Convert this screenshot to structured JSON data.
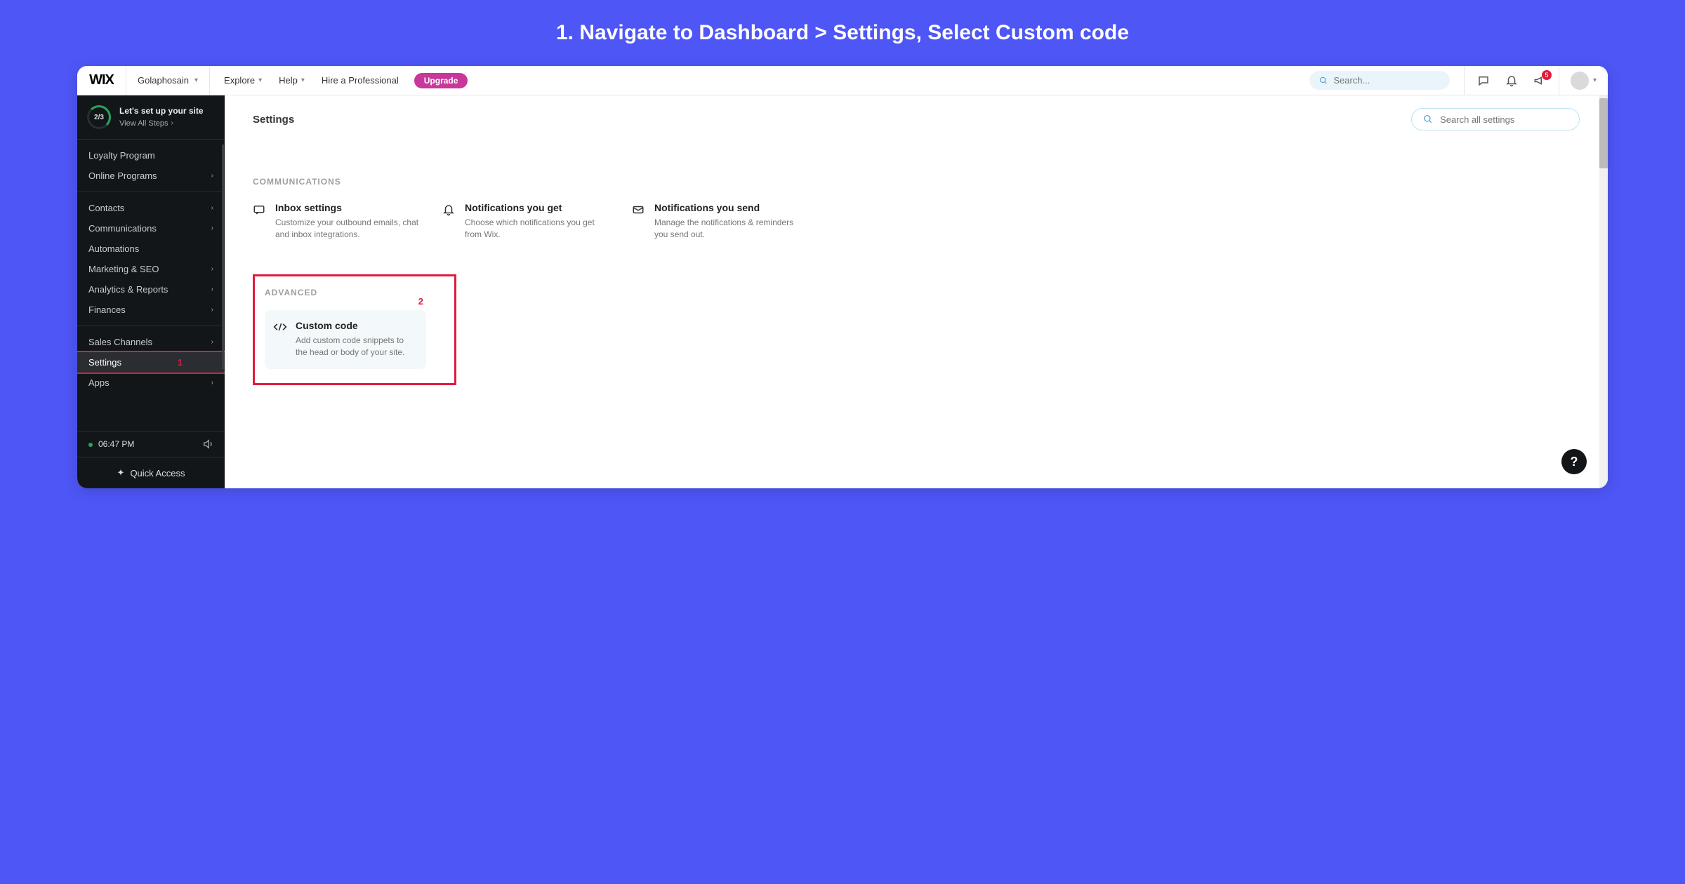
{
  "annotation_title": "1.  Navigate to Dashboard > Settings, Select Custom code",
  "topbar": {
    "logo": "WIX",
    "account_name": "Golaphosain",
    "nav": {
      "explore": "Explore",
      "help": "Help",
      "hire": "Hire a Professional"
    },
    "upgrade": "Upgrade",
    "search_placeholder": "Search...",
    "icon_badge": "5"
  },
  "sidebar": {
    "setup": {
      "progress": "2/3",
      "title": "Let's set up your site",
      "link": "View All Steps"
    },
    "group1": [
      "Loyalty Program",
      "Online Programs"
    ],
    "group2": [
      "Contacts",
      "Communications",
      "Automations",
      "Marketing & SEO",
      "Analytics & Reports",
      "Finances"
    ],
    "group3": [
      "Sales Channels",
      "Settings",
      "Apps"
    ],
    "time": "06:47 PM",
    "quick_access": "Quick Access"
  },
  "annotations": {
    "one": "1",
    "two": "2"
  },
  "content": {
    "page_title": "Settings",
    "search_placeholder": "Search all settings",
    "section_communications": {
      "label": "COMMUNICATIONS",
      "items": [
        {
          "title": "Inbox settings",
          "desc": "Customize your outbound emails, chat and inbox integrations."
        },
        {
          "title": "Notifications you get",
          "desc": "Choose which notifications you get from Wix."
        },
        {
          "title": "Notifications you send",
          "desc": "Manage the notifications & reminders you send out."
        }
      ]
    },
    "section_advanced": {
      "label": "ADVANCED",
      "items": [
        {
          "title": "Custom code",
          "desc": "Add custom code snippets to the head or body of your site."
        }
      ]
    }
  },
  "help_fab": "?"
}
